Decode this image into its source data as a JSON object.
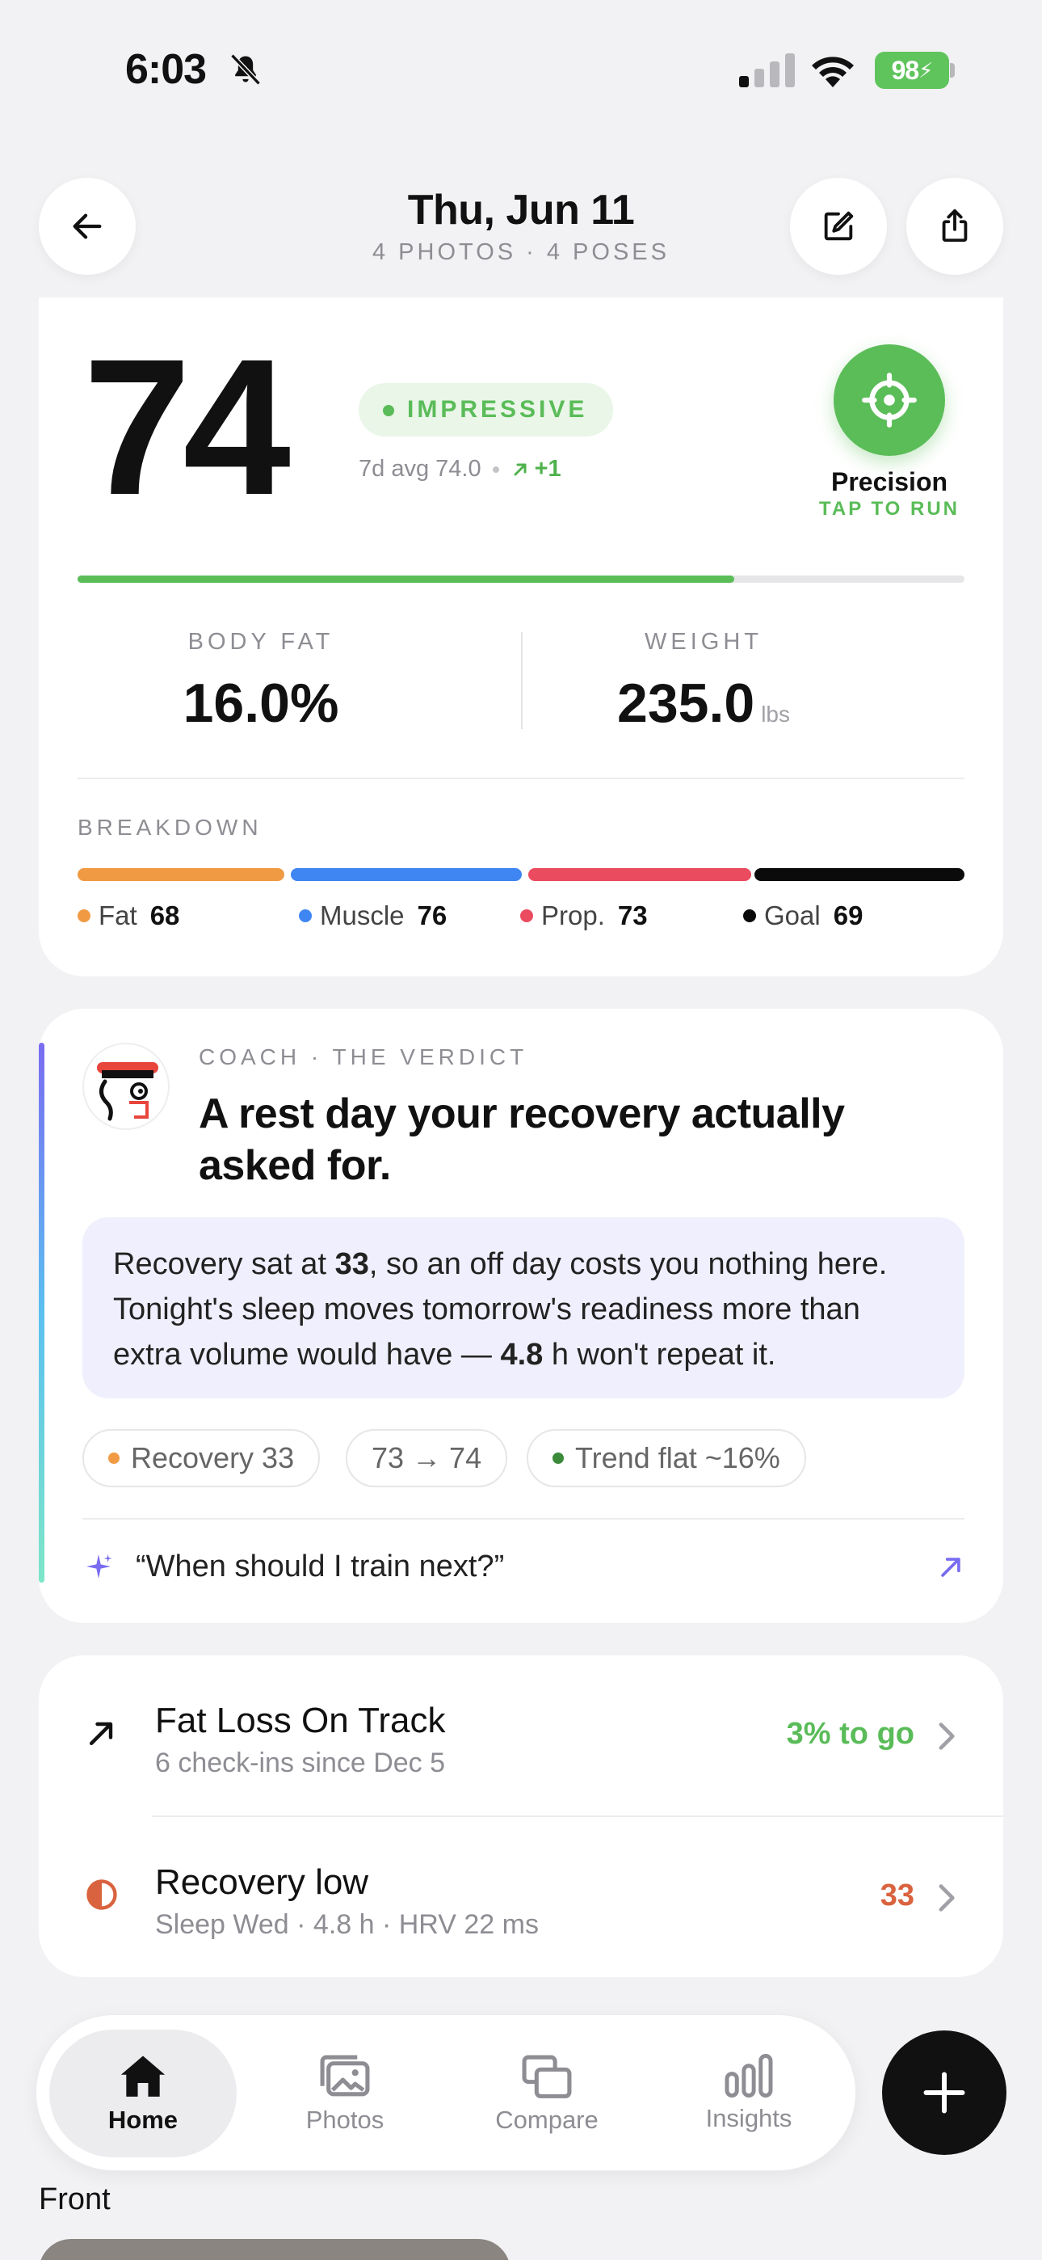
{
  "status_bar": {
    "time": "6:03",
    "battery": "98"
  },
  "header": {
    "title": "Thu, Jun 11",
    "subtitle": "4 PHOTOS · 4 POSES"
  },
  "score_card": {
    "score": "74",
    "rating": "IMPRESSIVE",
    "avg_text": "7d avg 74.0",
    "delta": "+1",
    "progress": 0.74,
    "precision_label": "Precision",
    "precision_action": "TAP TO RUN",
    "body_fat_label": "BODY FAT",
    "body_fat_value": "16.0%",
    "weight_label": "WEIGHT",
    "weight_value": "235.0",
    "weight_unit": "lbs",
    "breakdown_label": "BREAKDOWN",
    "breakdown": [
      {
        "label": "Fat",
        "value": "68",
        "color": "#f19a44"
      },
      {
        "label": "Muscle",
        "value": "76",
        "color": "#3f86f3"
      },
      {
        "label": "Prop.",
        "value": "73",
        "color": "#ea4b5e"
      },
      {
        "label": "Goal",
        "value": "69",
        "color": "#0b0b0b"
      }
    ]
  },
  "coach": {
    "eyebrow": "COACH · THE VERDICT",
    "headline": "A rest day your recovery actually asked for.",
    "body": {
      "p1": "Recovery sat at ",
      "b1": "33",
      "p2": ", so an off day costs you nothing here. Tonight's sleep moves tomorrow's readiness more than extra volume would have — ",
      "b2": "4.8",
      "p3": " h won't repeat it."
    },
    "chips": [
      {
        "label": "Recovery 33",
        "dot_color": "#f19a44"
      },
      {
        "label": "73 → 74",
        "dot_color": ""
      },
      {
        "label": "Trend flat ~16%",
        "dot_color": "#3a8a3a"
      }
    ],
    "ask": "“When should I train next?”"
  },
  "insights": [
    {
      "icon": "trend-arrow-icon",
      "title": "Fat Loss On Track",
      "subtitle": "6 check-ins since Dec 5",
      "value": "3% to go",
      "value_color": "#5abc58"
    },
    {
      "icon": "half-circle-icon",
      "title": "Recovery low",
      "subtitle": "Sleep Wed · 4.8 h · HRV 22 ms",
      "value": "33",
      "value_color": "#d9633f"
    }
  ],
  "tabs": [
    {
      "label": "Home",
      "icon": "home-icon",
      "active": true
    },
    {
      "label": "Photos",
      "icon": "photos-icon",
      "active": false
    },
    {
      "label": "Compare",
      "icon": "compare-icon",
      "active": false
    },
    {
      "label": "Insights",
      "icon": "insights-icon",
      "active": false
    }
  ],
  "section_label": "Front"
}
